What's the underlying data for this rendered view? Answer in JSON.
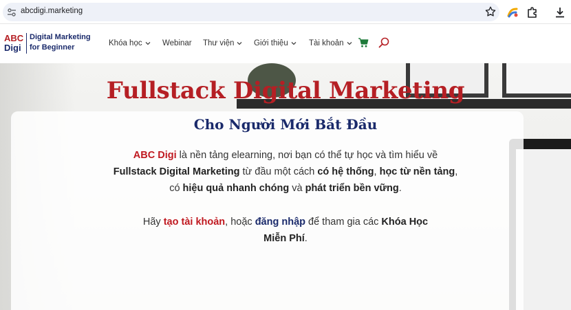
{
  "browser": {
    "url": "abcdigi.marketing",
    "icons": [
      "site-info-icon",
      "star-icon",
      "extension-color-icon",
      "puzzle-icon",
      "download-icon"
    ]
  },
  "header": {
    "logo": {
      "abc": "ABC",
      "digi": "Digi",
      "tagline_line1": "Digital Marketing",
      "tagline_line2": "for Beginner"
    },
    "nav": [
      {
        "label": "Khóa học",
        "dropdown": true
      },
      {
        "label": "Webinar",
        "dropdown": false
      },
      {
        "label": "Thư viện",
        "dropdown": true
      },
      {
        "label": "Giới thiệu",
        "dropdown": true
      },
      {
        "label": "Tài khoản",
        "dropdown": true
      }
    ],
    "icons": [
      "cart-icon",
      "search-icon"
    ]
  },
  "hero": {
    "title": "Fullstack Digital Marketing",
    "subtitle": "Cho Người Mới Bắt Đầu",
    "p1": {
      "brand": "ABC Digi",
      "t1": " là nền tảng elearning, nơi bạn có thể tự học và tìm hiểu về",
      "b1": "Fullstack Digital Marketing",
      "t2": " từ đầu một cách ",
      "b2": "có hệ thống",
      "t3": ", ",
      "b3": "học từ nền tảng",
      "t4": ",",
      "t5": "có ",
      "b4": "hiệu quả nhanh chóng",
      "t6": " và ",
      "b5": "phát triển bền vững",
      "t7": "."
    },
    "p2": {
      "t1": "Hãy ",
      "link1": "tạo tài khoản",
      "t2": ", hoặc ",
      "link2": "đăng nhập",
      "t3": " để tham gia các ",
      "b1": "Khóa Học",
      "b2": "Miễn Phí",
      "t4": "."
    }
  },
  "colors": {
    "brand_red": "#b51f24",
    "brand_navy": "#1a2a6b",
    "cart_green": "#1e7a3a"
  }
}
